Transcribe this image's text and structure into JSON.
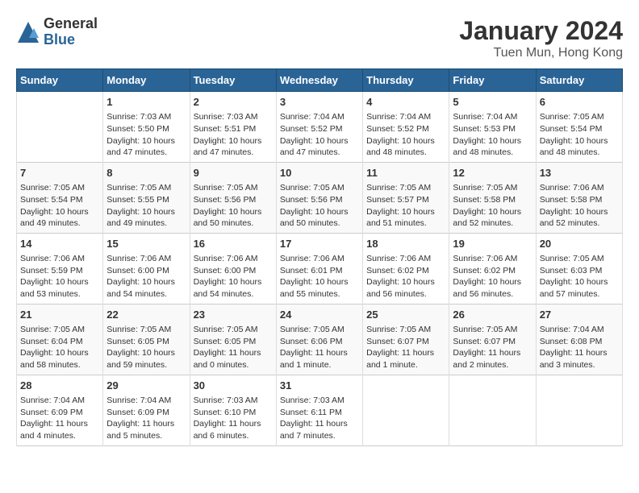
{
  "logo": {
    "general": "General",
    "blue": "Blue"
  },
  "title": "January 2024",
  "subtitle": "Tuen Mun, Hong Kong",
  "days_of_week": [
    "Sunday",
    "Monday",
    "Tuesday",
    "Wednesday",
    "Thursday",
    "Friday",
    "Saturday"
  ],
  "weeks": [
    [
      {
        "day": "",
        "info": ""
      },
      {
        "day": "1",
        "info": "Sunrise: 7:03 AM\nSunset: 5:50 PM\nDaylight: 10 hours\nand 47 minutes."
      },
      {
        "day": "2",
        "info": "Sunrise: 7:03 AM\nSunset: 5:51 PM\nDaylight: 10 hours\nand 47 minutes."
      },
      {
        "day": "3",
        "info": "Sunrise: 7:04 AM\nSunset: 5:52 PM\nDaylight: 10 hours\nand 47 minutes."
      },
      {
        "day": "4",
        "info": "Sunrise: 7:04 AM\nSunset: 5:52 PM\nDaylight: 10 hours\nand 48 minutes."
      },
      {
        "day": "5",
        "info": "Sunrise: 7:04 AM\nSunset: 5:53 PM\nDaylight: 10 hours\nand 48 minutes."
      },
      {
        "day": "6",
        "info": "Sunrise: 7:05 AM\nSunset: 5:54 PM\nDaylight: 10 hours\nand 48 minutes."
      }
    ],
    [
      {
        "day": "7",
        "info": "Sunrise: 7:05 AM\nSunset: 5:54 PM\nDaylight: 10 hours\nand 49 minutes."
      },
      {
        "day": "8",
        "info": "Sunrise: 7:05 AM\nSunset: 5:55 PM\nDaylight: 10 hours\nand 49 minutes."
      },
      {
        "day": "9",
        "info": "Sunrise: 7:05 AM\nSunset: 5:56 PM\nDaylight: 10 hours\nand 50 minutes."
      },
      {
        "day": "10",
        "info": "Sunrise: 7:05 AM\nSunset: 5:56 PM\nDaylight: 10 hours\nand 50 minutes."
      },
      {
        "day": "11",
        "info": "Sunrise: 7:05 AM\nSunset: 5:57 PM\nDaylight: 10 hours\nand 51 minutes."
      },
      {
        "day": "12",
        "info": "Sunrise: 7:05 AM\nSunset: 5:58 PM\nDaylight: 10 hours\nand 52 minutes."
      },
      {
        "day": "13",
        "info": "Sunrise: 7:06 AM\nSunset: 5:58 PM\nDaylight: 10 hours\nand 52 minutes."
      }
    ],
    [
      {
        "day": "14",
        "info": "Sunrise: 7:06 AM\nSunset: 5:59 PM\nDaylight: 10 hours\nand 53 minutes."
      },
      {
        "day": "15",
        "info": "Sunrise: 7:06 AM\nSunset: 6:00 PM\nDaylight: 10 hours\nand 54 minutes."
      },
      {
        "day": "16",
        "info": "Sunrise: 7:06 AM\nSunset: 6:00 PM\nDaylight: 10 hours\nand 54 minutes."
      },
      {
        "day": "17",
        "info": "Sunrise: 7:06 AM\nSunset: 6:01 PM\nDaylight: 10 hours\nand 55 minutes."
      },
      {
        "day": "18",
        "info": "Sunrise: 7:06 AM\nSunset: 6:02 PM\nDaylight: 10 hours\nand 56 minutes."
      },
      {
        "day": "19",
        "info": "Sunrise: 7:06 AM\nSunset: 6:02 PM\nDaylight: 10 hours\nand 56 minutes."
      },
      {
        "day": "20",
        "info": "Sunrise: 7:05 AM\nSunset: 6:03 PM\nDaylight: 10 hours\nand 57 minutes."
      }
    ],
    [
      {
        "day": "21",
        "info": "Sunrise: 7:05 AM\nSunset: 6:04 PM\nDaylight: 10 hours\nand 58 minutes."
      },
      {
        "day": "22",
        "info": "Sunrise: 7:05 AM\nSunset: 6:05 PM\nDaylight: 10 hours\nand 59 minutes."
      },
      {
        "day": "23",
        "info": "Sunrise: 7:05 AM\nSunset: 6:05 PM\nDaylight: 11 hours\nand 0 minutes."
      },
      {
        "day": "24",
        "info": "Sunrise: 7:05 AM\nSunset: 6:06 PM\nDaylight: 11 hours\nand 1 minute."
      },
      {
        "day": "25",
        "info": "Sunrise: 7:05 AM\nSunset: 6:07 PM\nDaylight: 11 hours\nand 1 minute."
      },
      {
        "day": "26",
        "info": "Sunrise: 7:05 AM\nSunset: 6:07 PM\nDaylight: 11 hours\nand 2 minutes."
      },
      {
        "day": "27",
        "info": "Sunrise: 7:04 AM\nSunset: 6:08 PM\nDaylight: 11 hours\nand 3 minutes."
      }
    ],
    [
      {
        "day": "28",
        "info": "Sunrise: 7:04 AM\nSunset: 6:09 PM\nDaylight: 11 hours\nand 4 minutes."
      },
      {
        "day": "29",
        "info": "Sunrise: 7:04 AM\nSunset: 6:09 PM\nDaylight: 11 hours\nand 5 minutes."
      },
      {
        "day": "30",
        "info": "Sunrise: 7:03 AM\nSunset: 6:10 PM\nDaylight: 11 hours\nand 6 minutes."
      },
      {
        "day": "31",
        "info": "Sunrise: 7:03 AM\nSunset: 6:11 PM\nDaylight: 11 hours\nand 7 minutes."
      },
      {
        "day": "",
        "info": ""
      },
      {
        "day": "",
        "info": ""
      },
      {
        "day": "",
        "info": ""
      }
    ]
  ]
}
